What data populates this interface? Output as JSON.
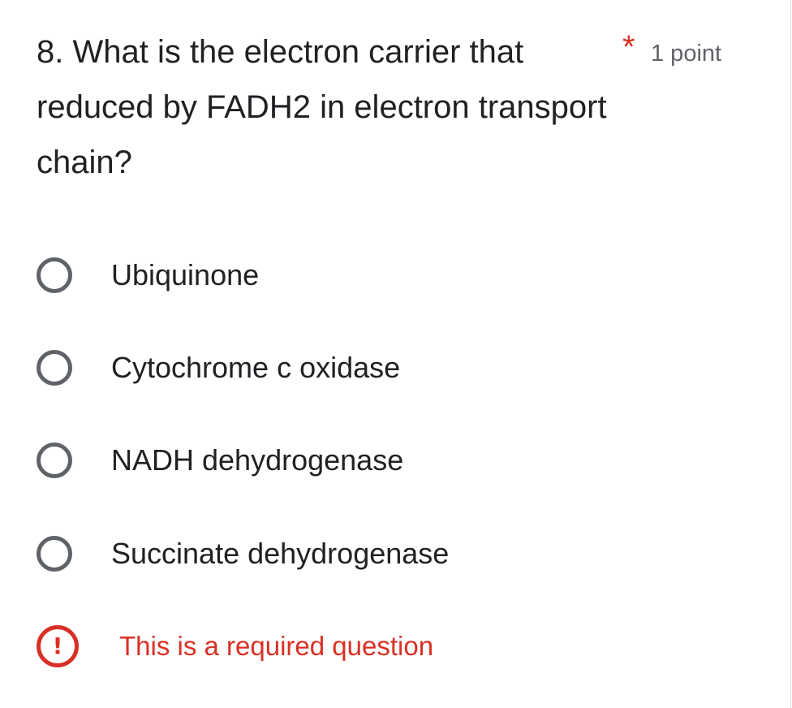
{
  "question": {
    "title": "8. What is the electron carrier that reduced by FADH2 in electron transport chain?",
    "required_marker": "*",
    "points": "1 point"
  },
  "options": [
    {
      "label": "Ubiquinone",
      "selected": false
    },
    {
      "label": "Cytochrome c oxidase",
      "selected": false
    },
    {
      "label": "NADH dehydrogenase",
      "selected": false
    },
    {
      "label": "Succinate dehydrogenase",
      "selected": false
    }
  ],
  "error": {
    "icon": "error-exclamation-icon",
    "icon_glyph": "!",
    "message": "This is a required question",
    "color": "#d93025"
  },
  "colors": {
    "text": "#202124",
    "secondary": "#5f6368",
    "required": "#d93025"
  }
}
